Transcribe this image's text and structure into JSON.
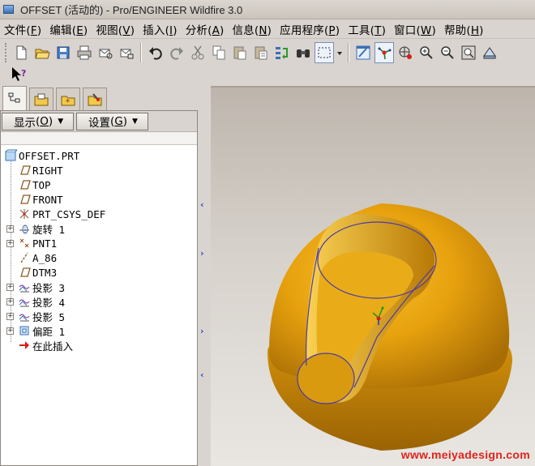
{
  "window": {
    "title": "OFFSET (活动的) - Pro/ENGINEER Wildfire 3.0"
  },
  "menu": [
    {
      "label": "文件",
      "accel": "F"
    },
    {
      "label": "编辑",
      "accel": "E"
    },
    {
      "label": "视图",
      "accel": "V"
    },
    {
      "label": "插入",
      "accel": "I"
    },
    {
      "label": "分析",
      "accel": "A"
    },
    {
      "label": "信息",
      "accel": "N"
    },
    {
      "label": "应用程序",
      "accel": "P"
    },
    {
      "label": "工具",
      "accel": "T"
    },
    {
      "label": "窗口",
      "accel": "W"
    },
    {
      "label": "帮助",
      "accel": "H"
    }
  ],
  "toolbar_icons": [
    "new-icon",
    "open-icon",
    "save-icon",
    "print-icon",
    "email-icon",
    "email-link-icon",
    "undo-icon",
    "redo-icon",
    "cut-icon",
    "copy-icon",
    "paste-icon",
    "paste-special-icon",
    "regenerate-icon",
    "find-icon",
    "selection-box-icon",
    "dropdown-arrow-icon",
    "repaint-icon",
    "spin-center-icon",
    "orient-mode-icon",
    "zoom-in-icon",
    "zoom-out-icon",
    "refit-icon",
    "reorient-icon"
  ],
  "tree_controls": {
    "show": {
      "label": "显示",
      "accel": "O"
    },
    "settings": {
      "label": "设置",
      "accel": "G"
    }
  },
  "model_tree": [
    {
      "label": "OFFSET.PRT",
      "icon": "part-icon",
      "level": 0,
      "expandable": false
    },
    {
      "label": "RIGHT",
      "icon": "datum-plane-icon",
      "level": 1,
      "expandable": false
    },
    {
      "label": "TOP",
      "icon": "datum-plane-icon",
      "level": 1,
      "expandable": false
    },
    {
      "label": "FRONT",
      "icon": "datum-plane-icon",
      "level": 1,
      "expandable": false
    },
    {
      "label": "PRT_CSYS_DEF",
      "icon": "csys-icon",
      "level": 1,
      "expandable": false
    },
    {
      "label": "旋转 1",
      "icon": "revolve-icon",
      "level": 1,
      "expandable": true
    },
    {
      "label": "PNT1",
      "icon": "datum-point-icon",
      "level": 1,
      "expandable": true
    },
    {
      "label": "A_86",
      "icon": "datum-axis-icon",
      "level": 1,
      "expandable": false
    },
    {
      "label": "DTM3",
      "icon": "datum-plane-icon",
      "level": 1,
      "expandable": false
    },
    {
      "label": "投影 3",
      "icon": "project-curve-icon",
      "level": 1,
      "expandable": true
    },
    {
      "label": "投影 4",
      "icon": "project-curve-icon",
      "level": 1,
      "expandable": true
    },
    {
      "label": "投影 5",
      "icon": "project-curve-icon",
      "level": 1,
      "expandable": true
    },
    {
      "label": "偏距 1",
      "icon": "offset-icon",
      "level": 1,
      "expandable": true
    },
    {
      "label": "在此插入",
      "icon": "insert-here-arrow-icon",
      "level": 1,
      "expandable": false
    }
  ],
  "viewport": {
    "background_top": "#bdb5ac",
    "background_bottom": "#e9e6e2",
    "model_color": "#e7a10e"
  },
  "watermark": "www.meiyadesign.com"
}
